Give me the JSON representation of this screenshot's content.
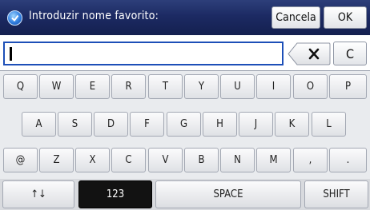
{
  "header": {
    "title": "Introduzir nome favorito:",
    "icon": "help-circle-icon",
    "cancel_label": "Cancela",
    "ok_label": "OK"
  },
  "input": {
    "value": ""
  },
  "keys": {
    "backspace_icon": "backspace-icon",
    "clear_label": "C",
    "row1": [
      "Q",
      "W",
      "E",
      "R",
      "T",
      "Y",
      "U",
      "I",
      "O",
      "P"
    ],
    "row2": [
      "A",
      "S",
      "D",
      "F",
      "G",
      "H",
      "J",
      "K",
      "L"
    ],
    "row3": [
      "@",
      "Z",
      "X",
      "C",
      "V",
      "B",
      "N",
      "M",
      ",",
      "."
    ],
    "bottom": {
      "toggle": "↑↓",
      "numbers": "123",
      "space": "SPACE",
      "shift": "SHIFT"
    }
  },
  "colors": {
    "header_bg": "#1c2a63",
    "input_border": "#1d4fb8",
    "active_key": "#121212"
  }
}
